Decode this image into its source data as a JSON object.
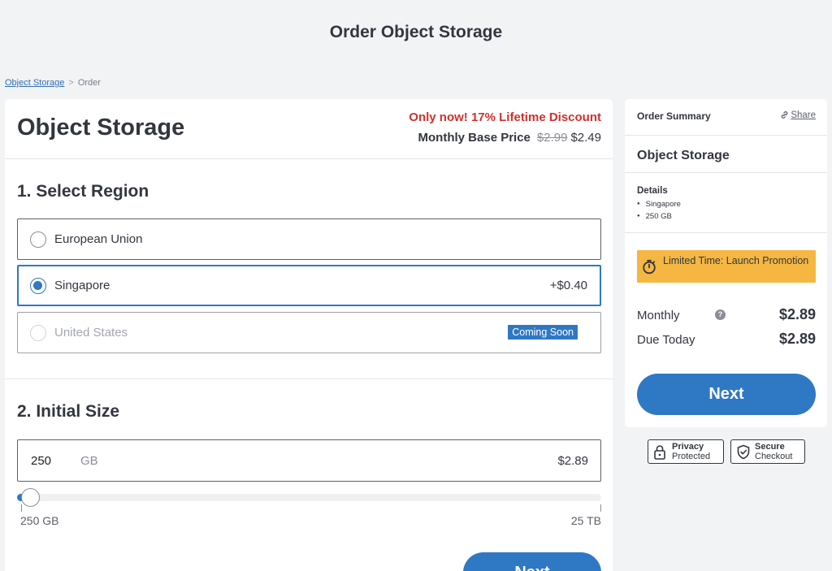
{
  "page": {
    "title": "Order Object Storage"
  },
  "breadcrumb": {
    "link": "Object Storage",
    "separator": ">",
    "current": "Order"
  },
  "product": {
    "title": "Object Storage",
    "promo": "Only now! 17% Lifetime Discount",
    "base_price_label": "Monthly Base Price",
    "old_price": "$2.99",
    "new_price": "$2.49"
  },
  "region": {
    "title": "1. Select Region",
    "options": [
      {
        "label": "European Union",
        "price": "",
        "selected": false,
        "disabled": false
      },
      {
        "label": "Singapore",
        "price": "+$0.40",
        "selected": true,
        "disabled": false
      },
      {
        "label": "United States",
        "badge": "Coming Soon",
        "selected": false,
        "disabled": true
      }
    ]
  },
  "size": {
    "title": "2. Initial Size",
    "value": "250",
    "unit": "GB",
    "price": "$2.89",
    "slider_min": "250 GB",
    "slider_max": "25 TB",
    "slider_fraction": 0.01
  },
  "buttons": {
    "next": "Next"
  },
  "summary": {
    "title": "Order Summary",
    "share": "Share",
    "product": "Object Storage",
    "details_title": "Details",
    "details": [
      "Singapore",
      "250 GB"
    ],
    "promo_banner": "Limited Time: Launch Promotion",
    "monthly_label": "Monthly",
    "monthly_value": "$2.89",
    "due_label": "Due Today",
    "due_value": "$2.89",
    "help": "?",
    "next": "Next"
  },
  "badges": {
    "privacy_title": "Privacy",
    "privacy_sub": "Protected",
    "secure_title": "Secure",
    "secure_sub": "Checkout"
  },
  "colors": {
    "accent": "#2f78c4",
    "promo_red": "#d0302c",
    "promo_banner": "#f5b742"
  }
}
